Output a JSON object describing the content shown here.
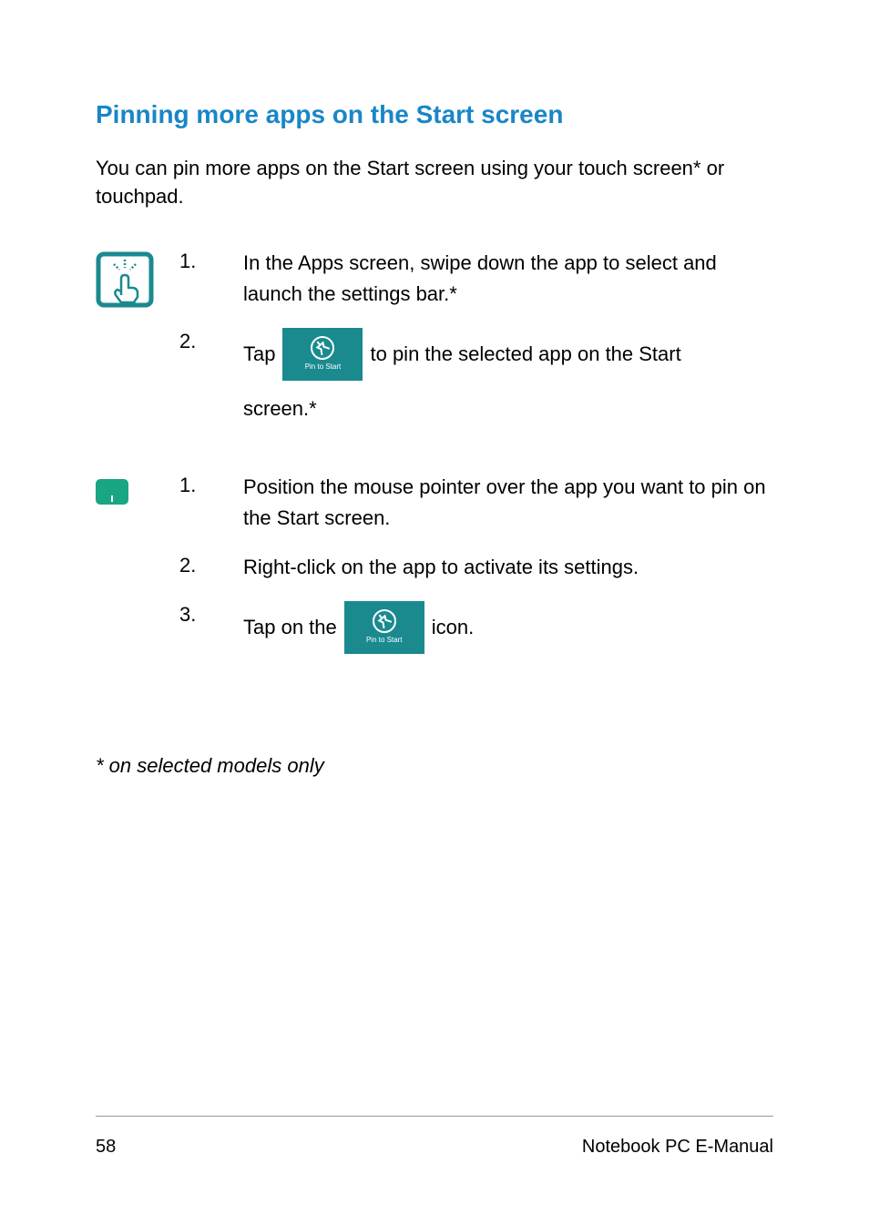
{
  "heading": "Pinning more apps on the Start screen",
  "intro": "You can pin more apps on the Start screen using your touch screen* or touchpad.",
  "pin_label": "Pin to Start",
  "touch": {
    "step1": {
      "num": "1.",
      "text": "In the Apps screen, swipe down the app to select and launch the settings bar.*"
    },
    "step2": {
      "num": "2.",
      "pre": "Tap",
      "post": "to pin the selected app on the Start",
      "cont": "screen.*"
    }
  },
  "touchpad": {
    "step1": {
      "num": "1.",
      "text": "Position the mouse pointer over the app you want to pin on the Start screen."
    },
    "step2": {
      "num": "2.",
      "text": "Right-click on the app to activate its settings."
    },
    "step3": {
      "num": "3.",
      "pre": "Tap on the",
      "post": "icon."
    }
  },
  "footnote": "* on selected models only",
  "footer": {
    "page": "58",
    "title": "Notebook PC E-Manual"
  }
}
